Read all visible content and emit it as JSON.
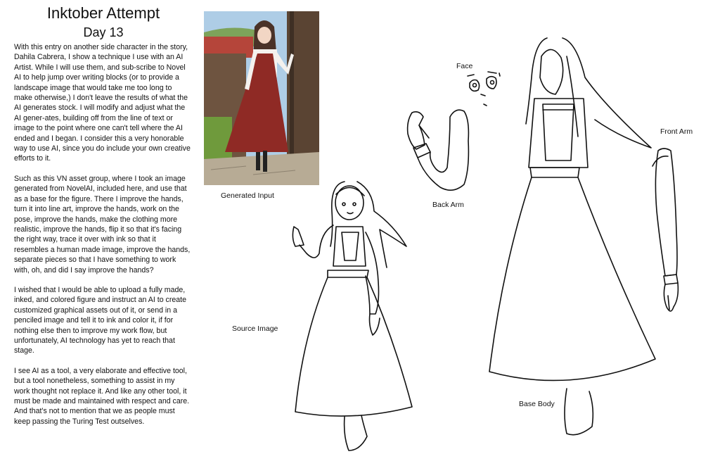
{
  "page": {
    "title": "Inktober Attempt",
    "subtitle": "Day 13"
  },
  "article": {
    "paragraphs": [
      "With this entry on another side character in the story, Dahila Cabrera, I show a technique I use with an AI Artist. While I will use them, and sub-scribe to Novel AI to help jump over writing blocks (or to provide a landscape image that would take me too long to make otherwise,) I don't leave the results of what the AI generates stock. I will modify and adjust what the AI gener-ates, building off from the line of text or image to the point where one can't tell where the AI ended and I began. I consider this a very honorable way to use AI, since you do include your own creative efforts to it.",
      "Such as this VN asset group, where I took an image generated from NovelAI, included here, and use that as a base for the figure. There I improve the hands, turn it into line art, improve the hands, work on the pose, improve the hands, make the clothing more realistic, improve the hands, flip it so that it's facing the right way, trace it over with ink so that it resembles a human made image, improve the hands, separate pieces so that I have something to work with, oh, and did I say improve the hands?",
      "I wished that I would be able to upload a fully made, inked, and colored figure and instruct an AI to create customized graphical assets out of it, or send in a penciled image and tell it to ink and color it, if for nothing else then to improve my work flow, but unfortunately, AI technology has yet to reach that stage.",
      "I see AI as a tool, a very elaborate and effective tool, but a tool nonetheless, something to assist in my work thought not replace it. And like any other tool, it must be made and maintained with respect and care. And that's not to mention that we as people must keep passing the Turing Test outselves."
    ]
  },
  "labels": {
    "generated_input": "Generated Input",
    "face": "Face",
    "back_arm": "Back Arm",
    "front_arm": "Front Arm",
    "source_image": "Source Image",
    "base_body": "Base Body"
  },
  "colors": {
    "dress": "#8f2a25",
    "sky": "#aecde6",
    "roof": "#b5453a",
    "wood": "#6e5440",
    "path": "#b7ab95",
    "grass": "#6f9a3c"
  }
}
